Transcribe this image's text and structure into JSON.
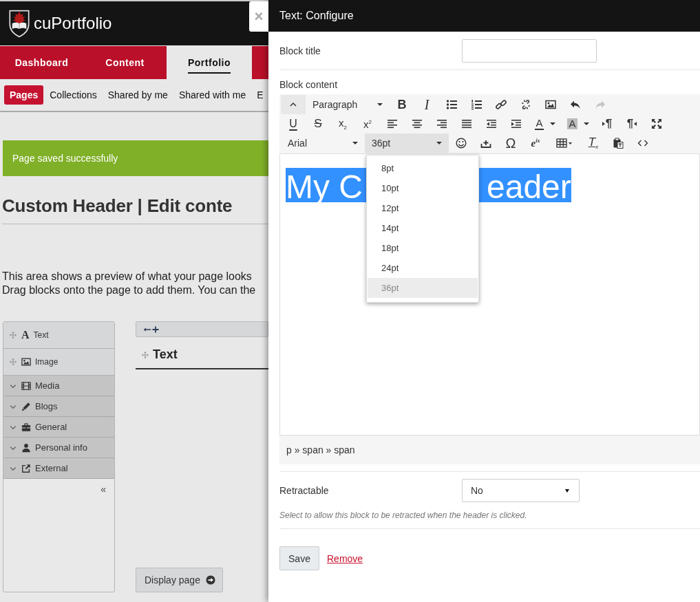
{
  "header": {
    "logo_text": "cuPortfolio",
    "close_label": "×"
  },
  "nav_tabs": [
    {
      "label": "Dashboard",
      "selected": false
    },
    {
      "label": "Content",
      "selected": false
    },
    {
      "label": "Portfolio",
      "selected": true
    }
  ],
  "sub_tabs": [
    {
      "label": "Pages",
      "selected": true
    },
    {
      "label": "Collections",
      "selected": false
    },
    {
      "label": "Shared by me",
      "selected": false
    },
    {
      "label": "Shared with me",
      "selected": false
    },
    {
      "label": "E",
      "selected": false
    }
  ],
  "alert": {
    "message": "Page saved successfully"
  },
  "page_title": "Custom Header | Edit conte",
  "intro_lines": [
    "This area shows a preview of what your page looks",
    "Drag blocks onto the page to add them. You can the"
  ],
  "block_palette": {
    "items": [
      {
        "label": "Text",
        "kind": "block",
        "icon_text": "A"
      },
      {
        "label": "Image",
        "kind": "block"
      },
      {
        "label": "Media",
        "kind": "category"
      },
      {
        "label": "Blogs",
        "kind": "category"
      },
      {
        "label": "General",
        "kind": "category"
      },
      {
        "label": "Personal info",
        "kind": "category"
      },
      {
        "label": "External",
        "kind": "category"
      }
    ],
    "collapse_label": "«"
  },
  "canvas": {
    "block_title": "Text"
  },
  "display_button": {
    "label": "Display page"
  },
  "config_panel": {
    "title": "Text: Configure",
    "block_title": {
      "label": "Block title"
    },
    "block_content": {
      "label": "Block content",
      "toolbar": [
        [
          {
            "kind": "icon",
            "disabled": false
          },
          {
            "kind": "select",
            "value": "Paragraph",
            "open": false
          },
          {
            "kind": "glyph",
            "text": "B",
            "disabled": false
          },
          {
            "kind": "glyph",
            "text": "I",
            "disabled": false
          },
          {
            "kind": "icon",
            "disabled": false
          },
          {
            "kind": "icon",
            "disabled": false
          },
          {
            "kind": "icon",
            "disabled": false
          },
          {
            "kind": "icon",
            "disabled": false
          },
          {
            "kind": "icon",
            "disabled": false
          },
          {
            "kind": "icon",
            "disabled": false
          },
          {
            "kind": "icon",
            "disabled": true
          }
        ],
        [
          {
            "kind": "glyph",
            "text": "U",
            "disabled": false
          },
          {
            "kind": "glyph",
            "text": "S",
            "disabled": false
          },
          {
            "kind": "glyph",
            "text": "x$_{2}$",
            "disabled": false
          },
          {
            "kind": "glyph",
            "text": "x$^{2}$",
            "disabled": false
          },
          {
            "kind": "icon",
            "disabled": false
          },
          {
            "kind": "icon",
            "disabled": false
          },
          {
            "kind": "icon",
            "disabled": false
          },
          {
            "kind": "icon",
            "disabled": false
          },
          {
            "kind": "icon",
            "disabled": false
          },
          {
            "kind": "icon",
            "disabled": false
          },
          {
            "kind": "color",
            "text": "A"
          },
          {
            "kind": "color",
            "text": "A"
          },
          {
            "kind": "glyph",
            "text": "¶",
            "disabled": false
          },
          {
            "kind": "glyph",
            "text": "¶",
            "disabled": false
          },
          {
            "kind": "icon",
            "disabled": false
          }
        ],
        [
          {
            "kind": "select",
            "value": "Arial",
            "open": false
          },
          {
            "kind": "select",
            "value": "36pt",
            "open": true
          },
          {
            "kind": "icon",
            "disabled": false
          },
          {
            "kind": "icon",
            "disabled": false
          },
          {
            "kind": "glyph",
            "text": "Ω",
            "disabled": false
          },
          {
            "kind": "glyph",
            "text": "e$^{ix}$",
            "disabled": false
          },
          {
            "kind": "icon",
            "disabled": false
          },
          {
            "kind": "glyph",
            "text": "T$_{x}$",
            "disabled": false
          },
          {
            "kind": "icon",
            "disabled": false
          },
          {
            "kind": "icon",
            "disabled": false
          }
        ]
      ],
      "size_menu": [
        {
          "label": "8pt",
          "selected": false
        },
        {
          "label": "10pt",
          "selected": false
        },
        {
          "label": "12pt",
          "selected": false
        },
        {
          "label": "14pt",
          "selected": false
        },
        {
          "label": "18pt",
          "selected": false
        },
        {
          "label": "24pt",
          "selected": false
        },
        {
          "label": "36pt",
          "selected": true
        }
      ],
      "content_parts": [
        "My C",
        "eader"
      ],
      "path": "p » span » span"
    },
    "retractable": {
      "label": "Retractable",
      "value": "No",
      "help": "Select to allow this block to be retracted when the header is clicked."
    },
    "save_label": "Save",
    "remove_label": "Remove"
  }
}
